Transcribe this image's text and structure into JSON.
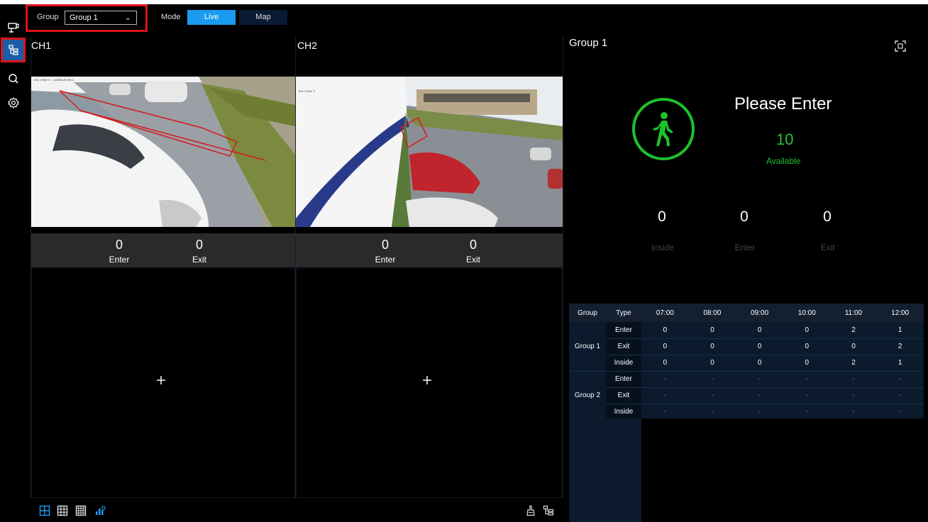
{
  "toolbar": {
    "group_label": "Group",
    "group_value": "Group 1",
    "mode_label": "Mode",
    "mode_live": "Live",
    "mode_map": "Map"
  },
  "channels": [
    {
      "title": "CH1",
      "enter_value": "0",
      "exit_value": "0",
      "enter_label": "Enter",
      "exit_label": "Exit"
    },
    {
      "title": "CH2",
      "enter_value": "0",
      "exit_value": "0",
      "enter_label": "Enter",
      "exit_label": "Exit"
    }
  ],
  "empty_cells": [
    "+",
    "+"
  ],
  "panel": {
    "title": "Group 1",
    "message": "Please Enter",
    "available_value": "10",
    "available_label": "Available",
    "inside_value": "0",
    "enter_value": "0",
    "exit_value": "0",
    "inside_label": "Inside",
    "enter_label": "Enter",
    "exit_label": "Exit"
  },
  "table": {
    "headers": [
      "Group",
      "Type",
      "07:00",
      "08:00",
      "09:00",
      "10:00",
      "11:00",
      "12:00"
    ],
    "groups": [
      {
        "name": "Group 1",
        "rows": [
          {
            "type": "Enter",
            "values": [
              "0",
              "0",
              "0",
              "0",
              "2",
              "1"
            ]
          },
          {
            "type": "Exit",
            "values": [
              "0",
              "0",
              "0",
              "0",
              "0",
              "2"
            ]
          },
          {
            "type": "Inside",
            "values": [
              "0",
              "0",
              "0",
              "0",
              "2",
              "1"
            ]
          }
        ]
      },
      {
        "name": "Group 2",
        "rows": [
          {
            "type": "Enter",
            "values": [
              "-",
              "-",
              "-",
              "-",
              "-",
              "-"
            ]
          },
          {
            "type": "Exit",
            "values": [
              "-",
              "-",
              "-",
              "-",
              "-",
              "-"
            ]
          },
          {
            "type": "Inside",
            "values": [
              "-",
              "-",
              "-",
              "-",
              "-",
              "-"
            ]
          }
        ]
      }
    ]
  },
  "colors": {
    "accent": "#1a9bf0",
    "highlight_red": "#e0121b",
    "available_green": "#29c02f"
  }
}
